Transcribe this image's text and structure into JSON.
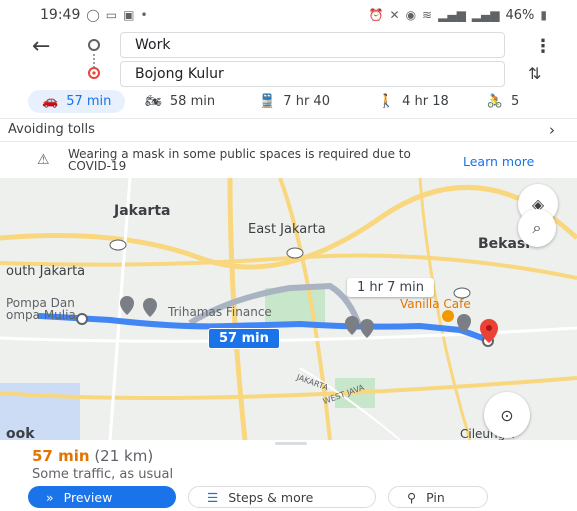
{
  "status_bar": {
    "time": "19:49",
    "battery": "46%"
  },
  "route": {
    "origin": "Work",
    "destination": "Bojong Kulur"
  },
  "modes": [
    {
      "icon": "car-icon",
      "label": "57 min"
    },
    {
      "icon": "motorcycle-icon",
      "label": "58 min"
    },
    {
      "icon": "transit-icon",
      "label": "7 hr 40"
    },
    {
      "icon": "walk-icon",
      "label": "4 hr 18"
    },
    {
      "icon": "bike-icon",
      "label": "5"
    }
  ],
  "avoid": {
    "label": "Avoiding tolls"
  },
  "notice": {
    "text": "Wearing a mask in some public spaces is required due to COVID-19",
    "link": "Learn more"
  },
  "map": {
    "labels": {
      "jakarta": "Jakarta",
      "east_jakarta": "East Jakarta",
      "bekasi": "Bekasi",
      "south_jakarta": "outh Jakarta",
      "pompa": "Pompa Dan",
      "pompa2": "ompa Mulia",
      "trihamas": "Trihamas Finance",
      "vanilla": "Vanilla Cafe",
      "cileungsi": "Cileungsi",
      "ook": "ook",
      "jakarta_road": "JAKARTA",
      "west_java": "WEST JAVA"
    },
    "route_time": "57 min",
    "alt_route_time": "1 hr 7 min",
    "colors": {
      "route": "#4285f4",
      "alt_route": "#a9b3c1",
      "destination_pin": "#ea4335"
    }
  },
  "sheet": {
    "time": "57 min",
    "distance": "(21 km)",
    "traffic": "Some traffic, as usual",
    "preview": "Preview",
    "steps": "Steps & more",
    "pin": "Pin"
  }
}
